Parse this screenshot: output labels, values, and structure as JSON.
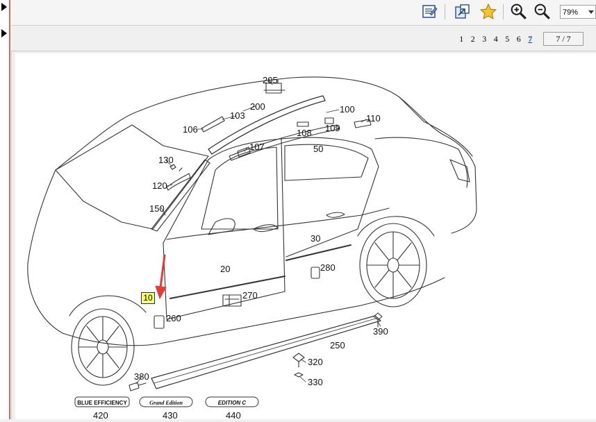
{
  "toolbar": {
    "zoom_value": "79%",
    "icons": [
      "annotate-icon",
      "open-window-icon",
      "favorite-star-icon",
      "zoom-in-icon",
      "zoom-out-icon"
    ]
  },
  "pagination": {
    "pages": [
      "1",
      "2",
      "3",
      "4",
      "5",
      "6",
      "7"
    ],
    "current": "7",
    "indicator": "7 / 7"
  },
  "diagram": {
    "highlight_label": "10",
    "callouts": [
      "205",
      "200",
      "100",
      "110",
      "103",
      "106",
      "107",
      "108",
      "109",
      "50",
      "130",
      "120",
      "150",
      "30",
      "20",
      "280",
      "270",
      "260",
      "390",
      "250",
      "320",
      "330",
      "380",
      "420",
      "430",
      "440"
    ],
    "badges": [
      "BLUE EFFICIENCY",
      "Grand Edition",
      "EDITION C"
    ]
  },
  "colors": {
    "arrow": "#e53b3b",
    "highlight": "#ffff66",
    "current_page": "#1a3fb8"
  }
}
